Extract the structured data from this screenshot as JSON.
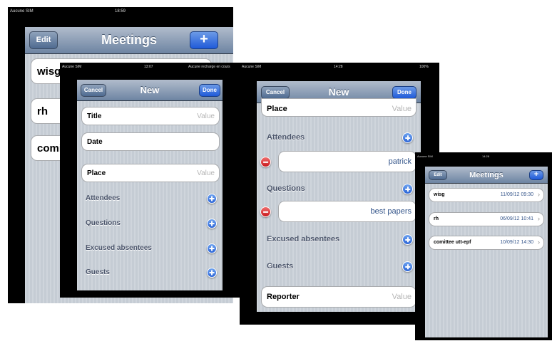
{
  "screen1": {
    "status": {
      "carrier": "Aucune SIM",
      "time": "18:59"
    },
    "nav": {
      "title": "Meetings",
      "edit_label": "Edit",
      "add_label": "+"
    },
    "rows": [
      "wisg",
      "rh",
      "comit"
    ]
  },
  "screen2": {
    "status": {
      "carrier": "Aucune SIM",
      "time": "13:07",
      "right": "Aucune recharge en cours"
    },
    "nav": {
      "title": "New",
      "cancel_label": "Cancel",
      "done_label": "Done"
    },
    "fields": {
      "title": {
        "label": "Title",
        "placeholder": "Value"
      },
      "date": {
        "label": "Date"
      },
      "place": {
        "label": "Place",
        "placeholder": "Value"
      }
    },
    "sections": [
      "Attendees",
      "Questions",
      "Excused absentees",
      "Guests"
    ]
  },
  "screen3": {
    "status": {
      "carrier": "Aucune SIM",
      "time": "14:28",
      "right": "100%"
    },
    "nav": {
      "title": "New",
      "cancel_label": "Cancel",
      "done_label": "Done"
    },
    "place": {
      "label": "Place",
      "placeholder": "Value"
    },
    "attendees": {
      "label": "Attendees",
      "value": "patrick"
    },
    "questions": {
      "label": "Questions",
      "value": "best papers"
    },
    "excused": {
      "label": "Excused absentees"
    },
    "guests": {
      "label": "Guests"
    },
    "reporter": {
      "label": "Reporter",
      "placeholder": "Value"
    }
  },
  "screen4": {
    "status": {
      "carrier": "Aucune SIM",
      "time": "14:28"
    },
    "nav": {
      "title": "Meetings",
      "edit_label": "Edit",
      "add_label": "+"
    },
    "meetings": [
      {
        "name": "wisg",
        "date": "11/09/12 09:30"
      },
      {
        "name": "rh",
        "date": "06/09/12 10:41"
      },
      {
        "name": "comittee utt-epf",
        "date": "10/09/12 14:30"
      }
    ]
  },
  "colors": {
    "background": "#c5ccd4",
    "navbar": "#6d84a2",
    "done": "#1f5ad9",
    "add": "#2a64d6",
    "delete": "#c8191c"
  }
}
